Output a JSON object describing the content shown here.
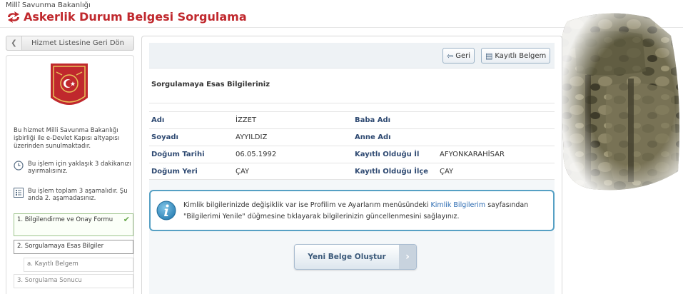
{
  "header": {
    "ministry": "Millî Savunma Bakanlığı",
    "title": "Askerlik Durum Belgesi Sorgulama"
  },
  "sidebar": {
    "back_label": "Hizmet Listesine Geri Dön",
    "description": "Bu hizmet Milli Savunma Bakanlığı işbirliği ile e-Devlet Kapısı altyapısı üzerinden sunulmaktadır.",
    "time_info": "Bu işlem için yaklaşık 3 dakikanızı ayırmalısınız.",
    "steps_info": "Bu işlem toplam 3 aşamalıdır. Şu anda 2. aşamadasınız.",
    "steps": [
      {
        "label": "1. Bilgilendirme ve Onay Formu"
      },
      {
        "label": "2. Sorgulamaya Esas Bilgiler"
      },
      {
        "label": "a. Kayıtlı Belgem"
      },
      {
        "label": "3. Sorgulama Sonucu"
      }
    ]
  },
  "toolbar": {
    "back_label": "Geri",
    "registered_label": "Kayıtlı Belgem"
  },
  "section": {
    "title": "Sorgulamaya Esas Bilgileriniz"
  },
  "fields": {
    "name_label": "Adı",
    "name_value": "İZZET",
    "father_label": "Baba Adı",
    "father_value": "",
    "surname_label": "Soyadı",
    "surname_value": "AYYILDIZ",
    "mother_label": "Anne Adı",
    "mother_value": "",
    "birthdate_label": "Doğum Tarihi",
    "birthdate_value": "06.05.1992",
    "province_label": "Kayıtlı Olduğu İl",
    "province_value": "AFYONKARAHİSAR",
    "birthplace_label": "Doğum Yeri",
    "birthplace_value": "ÇAY",
    "district_label": "Kayıtlı Olduğu İlçe",
    "district_value": "ÇAY"
  },
  "notice": {
    "part1": "Kimlik bilgilerinizde değişiklik var ise Profilim ve Ayarlarım menüsündeki ",
    "link": "Kimlik Bilgilerim",
    "part2": " sayfasından \"Bilgilerimi Yenile\" düğmesine tıklayarak bilgilerinizin güncellenmesini sağlayınız."
  },
  "cta": {
    "label": "Yeni Belge Oluştur"
  },
  "colors": {
    "brand_red": "#c0282d",
    "label_blue": "#2f4a72",
    "notice_border": "#56a0c4",
    "link_blue": "#2a6ab1"
  }
}
